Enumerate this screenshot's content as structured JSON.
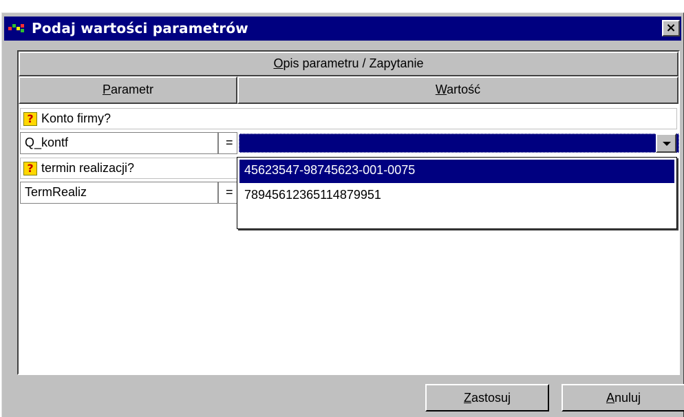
{
  "window": {
    "title": "Podaj wartości parametrów",
    "close_label": "×"
  },
  "table": {
    "header_main": {
      "first": "O",
      "rest": "pis parametru / Zapytanie"
    },
    "col_param": {
      "first": "P",
      "rest": "arametr"
    },
    "col_value": {
      "first": "W",
      "rest": "artość"
    }
  },
  "rows": [
    {
      "question": "Konto firmy?",
      "param": "Q_kontf",
      "eq": "=",
      "value": ""
    },
    {
      "question": "termin realizacji?",
      "param": "TermRealiz",
      "eq": "=",
      "value": ""
    }
  ],
  "question_icon": "?",
  "dropdown": {
    "options": [
      "45623547-98745623-001-0075",
      "78945612365114879951"
    ],
    "selected_index": 0
  },
  "buttons": {
    "apply": {
      "first": "Z",
      "rest": "astosuj"
    },
    "cancel": {
      "first": "A",
      "rest": "nuluj"
    }
  },
  "colors": {
    "titlebar": "#000080",
    "face": "#c0c0c0",
    "selection": "#000080"
  }
}
